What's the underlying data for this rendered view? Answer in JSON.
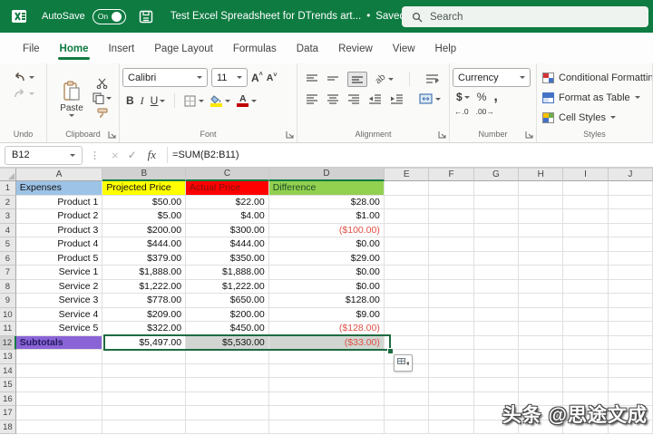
{
  "titlebar": {
    "bg_color": "#0E7B41",
    "autosave_label": "AutoSave",
    "autosave_state": "On",
    "doc_title": "Test Excel Spreadsheet for DTrends art...",
    "separator": "•",
    "saved_status": "Saved",
    "search_placeholder": "Search"
  },
  "tabs": [
    {
      "label": "File",
      "active": false
    },
    {
      "label": "Home",
      "active": true
    },
    {
      "label": "Insert",
      "active": false
    },
    {
      "label": "Page Layout",
      "active": false
    },
    {
      "label": "Formulas",
      "active": false
    },
    {
      "label": "Data",
      "active": false
    },
    {
      "label": "Review",
      "active": false
    },
    {
      "label": "View",
      "active": false
    },
    {
      "label": "Help",
      "active": false
    }
  ],
  "ribbon": {
    "undo_group_label": "Undo",
    "clipboard_group_label": "Clipboard",
    "paste_label": "Paste",
    "font_group_label": "Font",
    "font_name": "Calibri",
    "font_size": "11",
    "glyph_bold": "B",
    "glyph_italic": "I",
    "glyph_underline": "U",
    "glyph_grow_font": "A",
    "glyph_shrink_font": "A",
    "glyph_font_color": "A",
    "glyph_orientation": "ab",
    "alignment_group_label": "Alignment",
    "number_group_label": "Number",
    "number_format": "Currency",
    "glyph_currency": "$",
    "glyph_percent": "%",
    "glyph_comma": ",",
    "glyph_dec_increase": "←.0",
    "glyph_dec_decrease": ".00→",
    "styles_group_label": "Styles",
    "conditional_formatting_label": "Conditional Formatting",
    "format_as_table_label": "Format as Table",
    "cell_styles_label": "Cell Styles"
  },
  "formula_bar": {
    "name_box": "B12",
    "cancel_glyph": "×",
    "enter_glyph": "✓",
    "fx_label": "fx",
    "formula": "=SUM(B2:B11)"
  },
  "sheet": {
    "columns": [
      "A",
      "B",
      "C",
      "D",
      "E",
      "F",
      "G",
      "H",
      "I",
      "J"
    ],
    "selected_columns": [
      "B",
      "C",
      "D"
    ],
    "selected_row_number": 12,
    "active_cell": "B12",
    "colors": {
      "expenses_fill": "#9DC3E6",
      "projected_fill": "#FFFF00",
      "actual_fill": "#FF0000",
      "actual_text": "#7F1010",
      "difference_fill": "#92D050",
      "difference_text": "#1E4D23",
      "subtotals_fill": "#8A64D6",
      "subtotals_text": "#241A5E",
      "negative_text": "#E05045",
      "selection_fill": "#D2D6D2",
      "selection_border": "#1E6B41"
    },
    "rows": [
      {
        "n": 1,
        "cells": [
          {
            "t": "Expenses",
            "bg": "#9DC3E6",
            "fg": "#101010",
            "align": "left"
          },
          {
            "t": "Projected Price",
            "bg": "#FFFF00",
            "fg": "#101010",
            "align": "left"
          },
          {
            "t": "Actual Price",
            "bg": "#FF0000",
            "fg": "#7F1010",
            "align": "left"
          },
          {
            "t": "Difference",
            "bg": "#92D050",
            "fg": "#1E4D23",
            "align": "left"
          }
        ]
      },
      {
        "n": 2,
        "cells": [
          {
            "t": "Product 1"
          },
          {
            "t": "$50.00"
          },
          {
            "t": "$22.00"
          },
          {
            "t": "$28.00"
          }
        ]
      },
      {
        "n": 3,
        "cells": [
          {
            "t": "Product 2"
          },
          {
            "t": "$5.00"
          },
          {
            "t": "$4.00"
          },
          {
            "t": "$1.00"
          }
        ]
      },
      {
        "n": 4,
        "cells": [
          {
            "t": "Product 3"
          },
          {
            "t": "$200.00"
          },
          {
            "t": "$300.00"
          },
          {
            "t": "($100.00)",
            "fg": "#E05045"
          }
        ]
      },
      {
        "n": 5,
        "cells": [
          {
            "t": "Product 4"
          },
          {
            "t": "$444.00"
          },
          {
            "t": "$444.00"
          },
          {
            "t": "$0.00"
          }
        ]
      },
      {
        "n": 6,
        "cells": [
          {
            "t": "Product 5"
          },
          {
            "t": "$379.00"
          },
          {
            "t": "$350.00"
          },
          {
            "t": "$29.00"
          }
        ]
      },
      {
        "n": 7,
        "cells": [
          {
            "t": "Service 1"
          },
          {
            "t": "$1,888.00"
          },
          {
            "t": "$1,888.00"
          },
          {
            "t": "$0.00"
          }
        ]
      },
      {
        "n": 8,
        "cells": [
          {
            "t": "Service 2"
          },
          {
            "t": "$1,222.00"
          },
          {
            "t": "$1,222.00"
          },
          {
            "t": "$0.00"
          }
        ]
      },
      {
        "n": 9,
        "cells": [
          {
            "t": "Service 3"
          },
          {
            "t": "$778.00"
          },
          {
            "t": "$650.00"
          },
          {
            "t": "$128.00"
          }
        ]
      },
      {
        "n": 10,
        "cells": [
          {
            "t": "Service 4"
          },
          {
            "t": "$209.00"
          },
          {
            "t": "$200.00"
          },
          {
            "t": "$9.00"
          }
        ]
      },
      {
        "n": 11,
        "cells": [
          {
            "t": "Service 5"
          },
          {
            "t": "$322.00"
          },
          {
            "t": "$450.00"
          },
          {
            "t": "($128.00)",
            "fg": "#E05045"
          }
        ]
      },
      {
        "n": 12,
        "cells": [
          {
            "t": "Subtotals",
            "bg": "#8A64D6",
            "fg": "#241A5E",
            "align": "left",
            "bold": true
          },
          {
            "t": "$5,497.00",
            "bg": "#FFFFFF"
          },
          {
            "t": "$5,530.00",
            "bg": "#D2D6D2"
          },
          {
            "t": "($33.00)",
            "bg": "#D2D6D2",
            "fg": "#E05045"
          }
        ]
      },
      {
        "n": 13,
        "cells": []
      },
      {
        "n": 14,
        "cells": []
      },
      {
        "n": 15,
        "cells": []
      },
      {
        "n": 16,
        "cells": []
      },
      {
        "n": 17,
        "cells": []
      },
      {
        "n": 18,
        "cells": []
      }
    ]
  },
  "watermark": {
    "text": "头条 @思途文成"
  }
}
